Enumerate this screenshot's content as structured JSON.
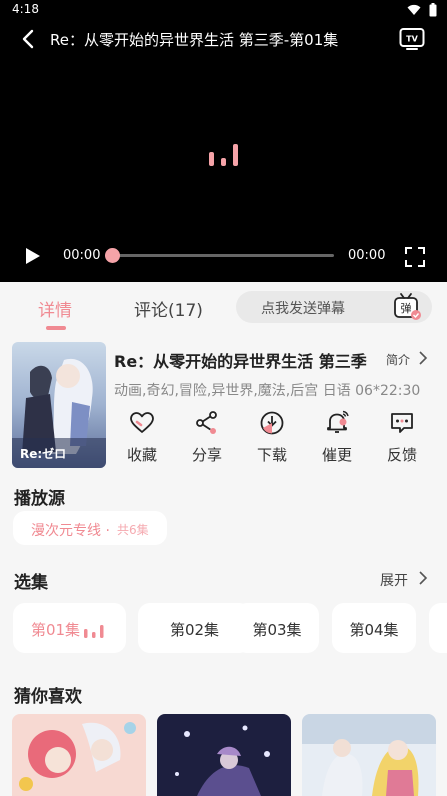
{
  "status": {
    "time": "4:18"
  },
  "player": {
    "title": "Re：从零开始的异世界生活 第三季-第01集",
    "current_time": "00:00",
    "total_time": "00:00",
    "progress": 0
  },
  "tabs": {
    "detail": "详情",
    "comments": "评论(17)",
    "danmaku_placeholder": "点我发送弹幕",
    "danmaku_icon_text": "弹"
  },
  "anime": {
    "title": "Re：从零开始的异世界生活 第三季",
    "intro": "简介",
    "tags": "动画,奇幻,冒险,异世界,魔法,后宫 日语 06*22:30",
    "poster_logo": "Re:ゼロ"
  },
  "actions": [
    {
      "label": "收藏",
      "icon": "heart-icon"
    },
    {
      "label": "分享",
      "icon": "share-icon"
    },
    {
      "label": "下载",
      "icon": "download-icon"
    },
    {
      "label": "催更",
      "icon": "bell-icon"
    },
    {
      "label": "反馈",
      "icon": "feedback-icon"
    }
  ],
  "source": {
    "heading": "播放源",
    "name": "漫次元专线 ·",
    "count": "共6集"
  },
  "episodes": {
    "heading": "选集",
    "expand": "展开",
    "items": [
      "第01集",
      "第02集",
      "第03集",
      "第04集"
    ]
  },
  "recommend": {
    "heading": "猜你喜欢"
  },
  "colors": {
    "accent": "#f08a92",
    "background": "#f6f6f6"
  }
}
